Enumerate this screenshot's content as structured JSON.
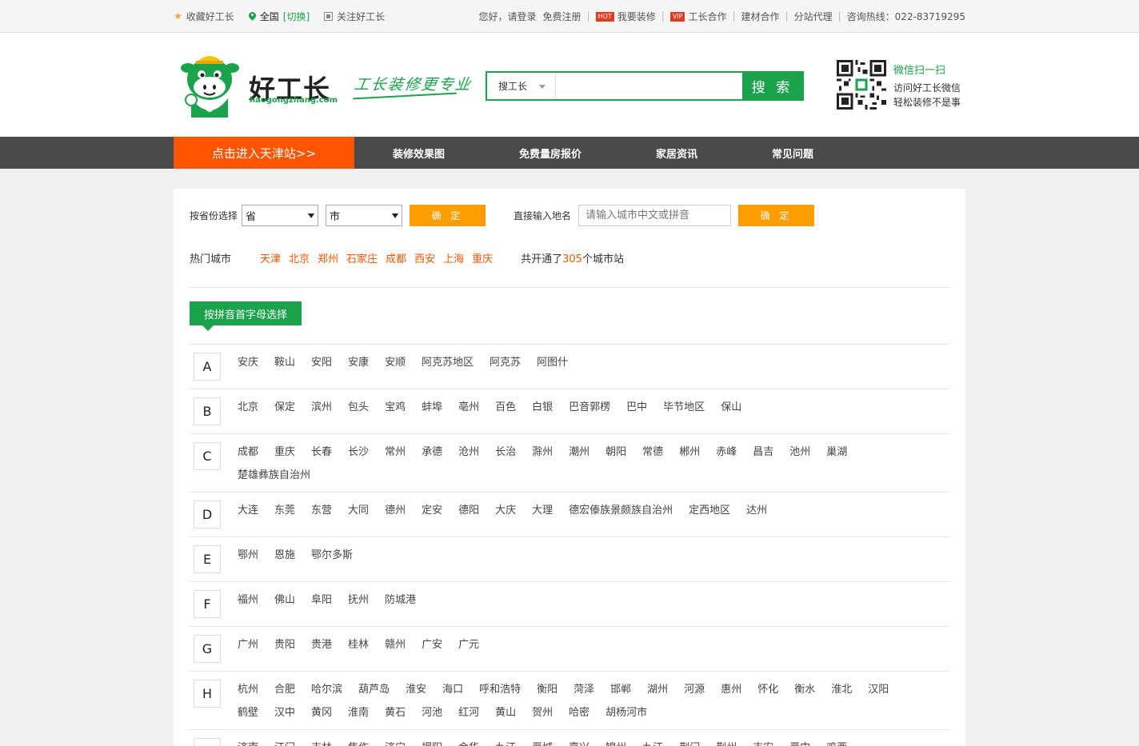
{
  "topbar": {
    "favorite": "收藏好工长",
    "location_name": "全国",
    "location_switch": "[切换]",
    "follow": "关注好工长",
    "hello": "您好，请登录",
    "register": "免费注册",
    "hot_badge": "HOT",
    "decorate": "我要装修",
    "vip_badge": "VIP",
    "cooperate": "工长合作",
    "material": "建材合作",
    "agent": "分站代理",
    "hotline": "咨询热线：022-83719295"
  },
  "header": {
    "brand": "好工长",
    "brand_domain": "haogongzhang.com",
    "slogan": "工长装修更专业",
    "search_type": "搜工长",
    "search_value": "",
    "search_button": "搜 索",
    "wechat_title": "微信扫一扫",
    "wechat_line1": "访问好工长微信",
    "wechat_line2": "轻松装修不是事"
  },
  "nav": {
    "enter": "点击进入天津站>>",
    "items": [
      "装修效果图",
      "免费量房报价",
      "家居资讯",
      "常见问题"
    ]
  },
  "filter": {
    "province_label": "按省份选择",
    "province_value": "省",
    "city_value": "市",
    "confirm": "确 定",
    "input_label": "直接输入地名",
    "input_placeholder": "请输入城市中文或拼音",
    "hot_label": "热门城市",
    "hot_cities": [
      "天津",
      "北京",
      "郑州",
      "石家庄",
      "成都",
      "西安",
      "上海",
      "重庆"
    ],
    "total_prefix": "共开通了",
    "total_num": "305",
    "total_suffix": "个城市站"
  },
  "pinyin_tab": "按拼音首字母选择",
  "groups": [
    {
      "letter": "A",
      "cities": [
        "安庆",
        "鞍山",
        "安阳",
        "安康",
        "安顺",
        "阿克苏地区",
        "阿克苏",
        "阿图什"
      ]
    },
    {
      "letter": "B",
      "cities": [
        "北京",
        "保定",
        "滨州",
        "包头",
        "宝鸡",
        "蚌埠",
        "亳州",
        "百色",
        "白银",
        "巴音郭楞",
        "巴中",
        "毕节地区",
        "保山"
      ]
    },
    {
      "letter": "C",
      "cities": [
        "成都",
        "重庆",
        "长春",
        "长沙",
        "常州",
        "承德",
        "沧州",
        "长治",
        "滁州",
        "潮州",
        "朝阳",
        "常德",
        "郴州",
        "赤峰",
        "昌吉",
        "池州",
        "巢湖",
        "楚雄彝族自治州"
      ]
    },
    {
      "letter": "D",
      "cities": [
        "大连",
        "东莞",
        "东营",
        "大同",
        "德州",
        "定安",
        "德阳",
        "大庆",
        "大理",
        "德宏傣族景颇族自治州",
        "定西地区",
        "达州"
      ]
    },
    {
      "letter": "E",
      "cities": [
        "鄂州",
        "恩施",
        "鄂尔多斯"
      ]
    },
    {
      "letter": "F",
      "cities": [
        "福州",
        "佛山",
        "阜阳",
        "抚州",
        "防城港"
      ]
    },
    {
      "letter": "G",
      "cities": [
        "广州",
        "贵阳",
        "贵港",
        "桂林",
        "赣州",
        "广安",
        "广元"
      ]
    },
    {
      "letter": "H",
      "cities": [
        "杭州",
        "合肥",
        "哈尔滨",
        "葫芦岛",
        "淮安",
        "海口",
        "呼和浩特",
        "衡阳",
        "菏泽",
        "邯郸",
        "湖州",
        "河源",
        "惠州",
        "怀化",
        "衡水",
        "淮北",
        "汉阳",
        "鹤壁",
        "汉中",
        "黄冈",
        "淮南",
        "黄石",
        "河池",
        "红河",
        "黄山",
        "贺州",
        "哈密",
        "胡杨河市"
      ]
    },
    {
      "letter": "J",
      "cities": [
        "济南",
        "江门",
        "吉林",
        "焦作",
        "济宁",
        "揭阳",
        "金华",
        "九江",
        "晋城",
        "嘉兴",
        "锦州",
        "九江",
        "荆门",
        "荆州",
        "吉安",
        "晋中",
        "鸡西"
      ]
    }
  ]
}
